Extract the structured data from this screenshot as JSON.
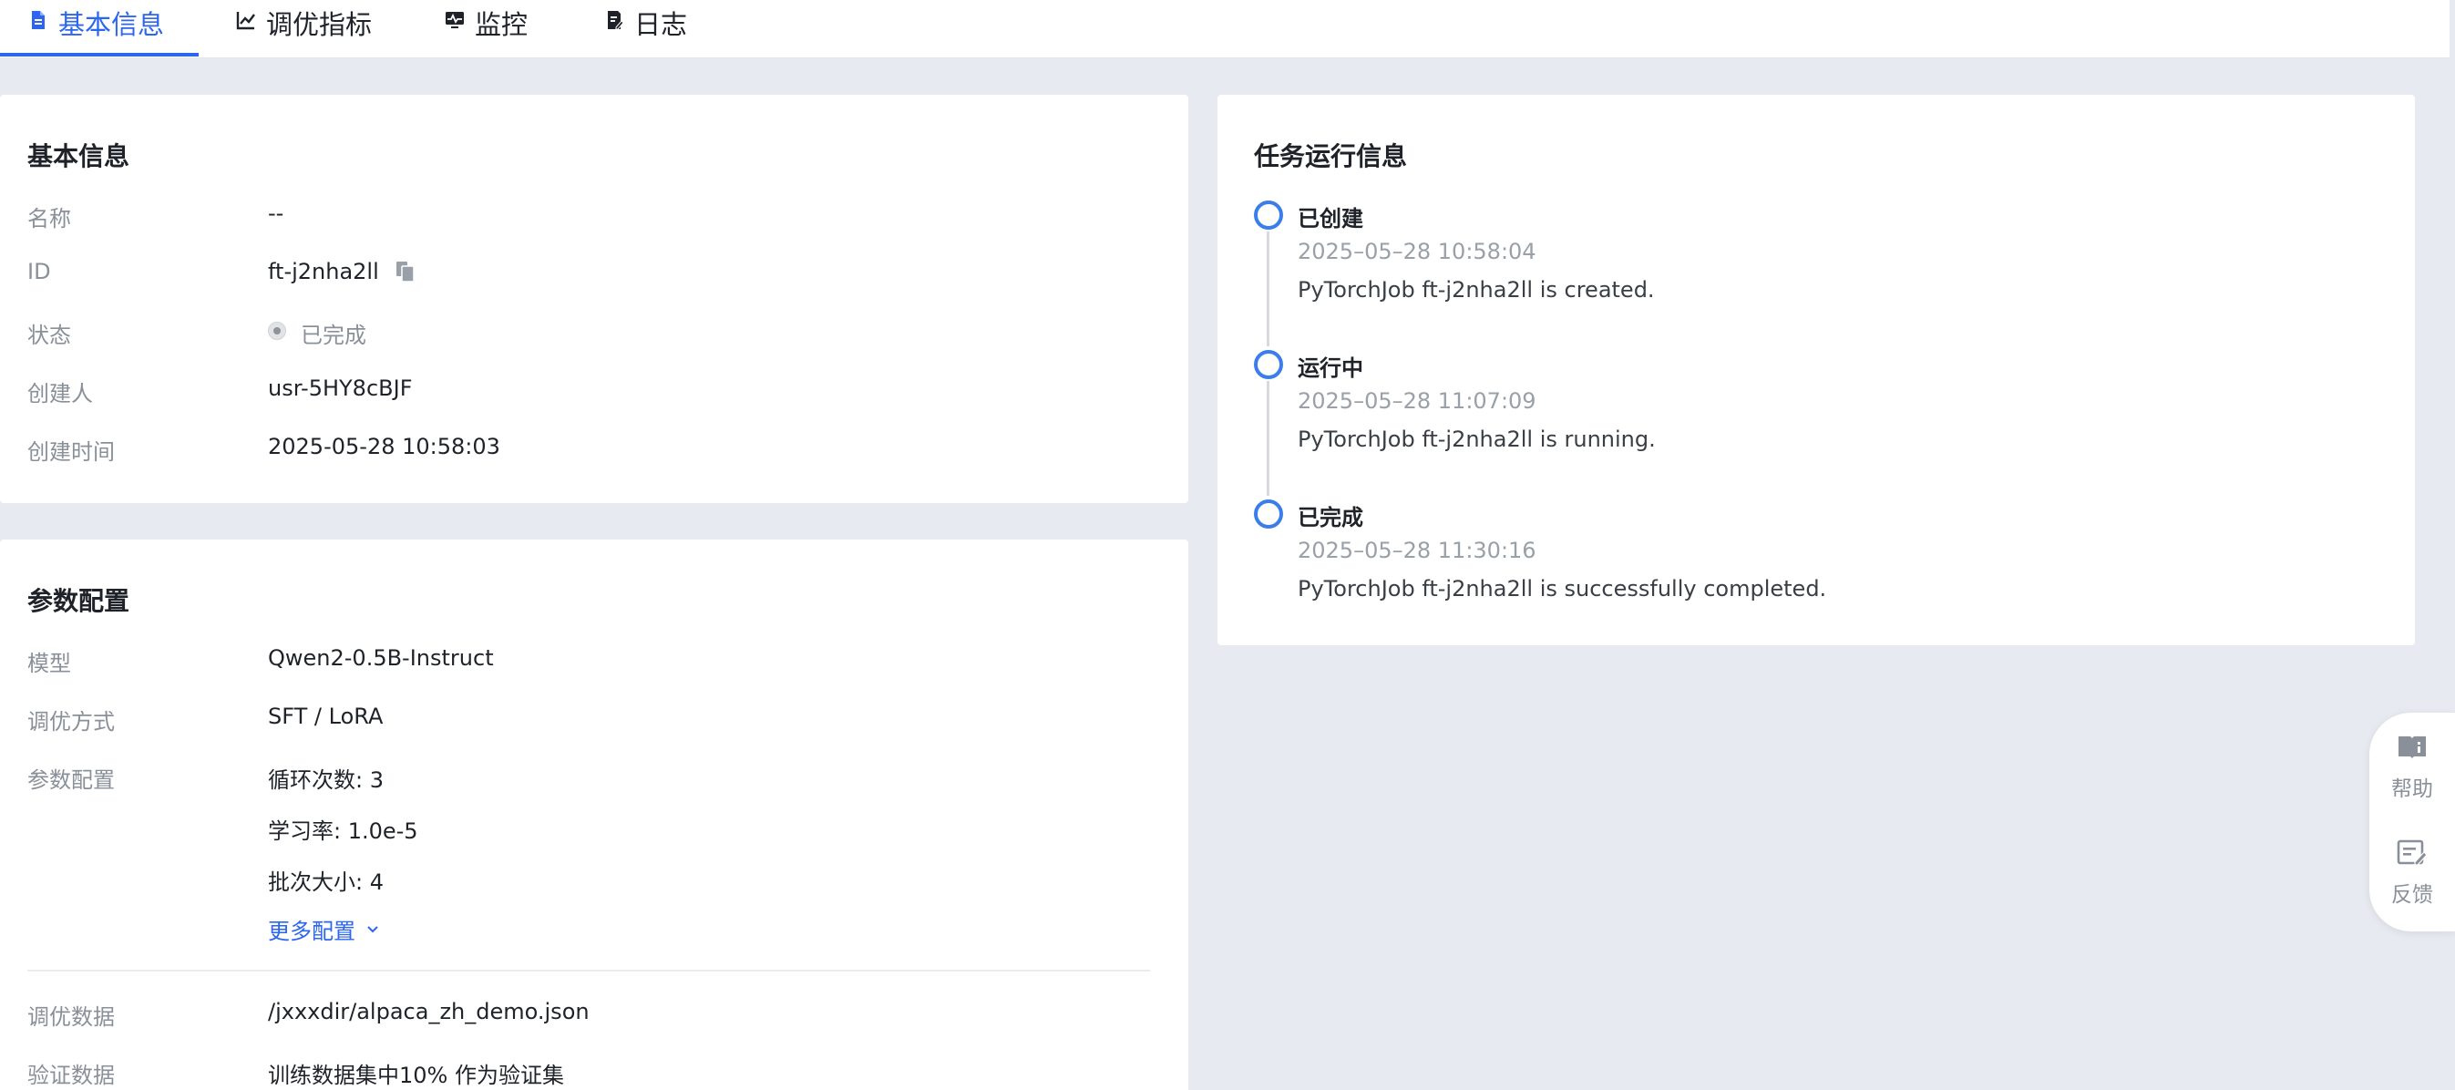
{
  "tabs": [
    {
      "label": "基本信息",
      "icon": "document-icon",
      "active": true
    },
    {
      "label": "调优指标",
      "icon": "line-chart-icon",
      "active": false
    },
    {
      "label": "监控",
      "icon": "monitor-icon",
      "active": false
    },
    {
      "label": "日志",
      "icon": "log-icon",
      "active": false
    }
  ],
  "basic_info": {
    "title": "基本信息",
    "rows": {
      "name": {
        "label": "名称",
        "value": "--"
      },
      "id": {
        "label": "ID",
        "value": "ft-j2nha2ll"
      },
      "status": {
        "label": "状态",
        "value": "已完成"
      },
      "creator": {
        "label": "创建人",
        "value": "usr-5HY8cBJF"
      },
      "created_at": {
        "label": "创建时间",
        "value": "2025-05-28 10:58:03"
      }
    }
  },
  "params": {
    "title": "参数配置",
    "model": {
      "label": "模型",
      "value": "Qwen2-0.5B-Instruct"
    },
    "method": {
      "label": "调优方式",
      "value": "SFT / LoRA"
    },
    "config": {
      "label": "参数配置",
      "items": [
        "循环次数: 3",
        "学习率: 1.0e-5",
        "批次大小: 4"
      ],
      "more_label": "更多配置"
    },
    "train_data": {
      "label": "调优数据",
      "value": "/jxxxdir/alpaca_zh_demo.json"
    },
    "val_data": {
      "label": "验证数据",
      "value": "训练数据集中10% 作为验证集"
    }
  },
  "task_run": {
    "title": "任务运行信息",
    "events": [
      {
        "title": "已创建",
        "time": "2025–05–28 10:58:04",
        "desc": "PyTorchJob ft-j2nha2ll is created."
      },
      {
        "title": "运行中",
        "time": "2025–05–28 11:07:09",
        "desc": "PyTorchJob ft-j2nha2ll is running."
      },
      {
        "title": "已完成",
        "time": "2025–05–28 11:30:16",
        "desc": "PyTorchJob ft-j2nha2ll is successfully completed."
      }
    ]
  },
  "side_panel": {
    "help": {
      "label": "帮助",
      "icon": "book-icon"
    },
    "feedback": {
      "label": "反馈",
      "icon": "feedback-icon"
    }
  },
  "colors": {
    "accent": "#2b65f0",
    "timeline": "#3b7ee8",
    "background": "#e7ebf1"
  }
}
